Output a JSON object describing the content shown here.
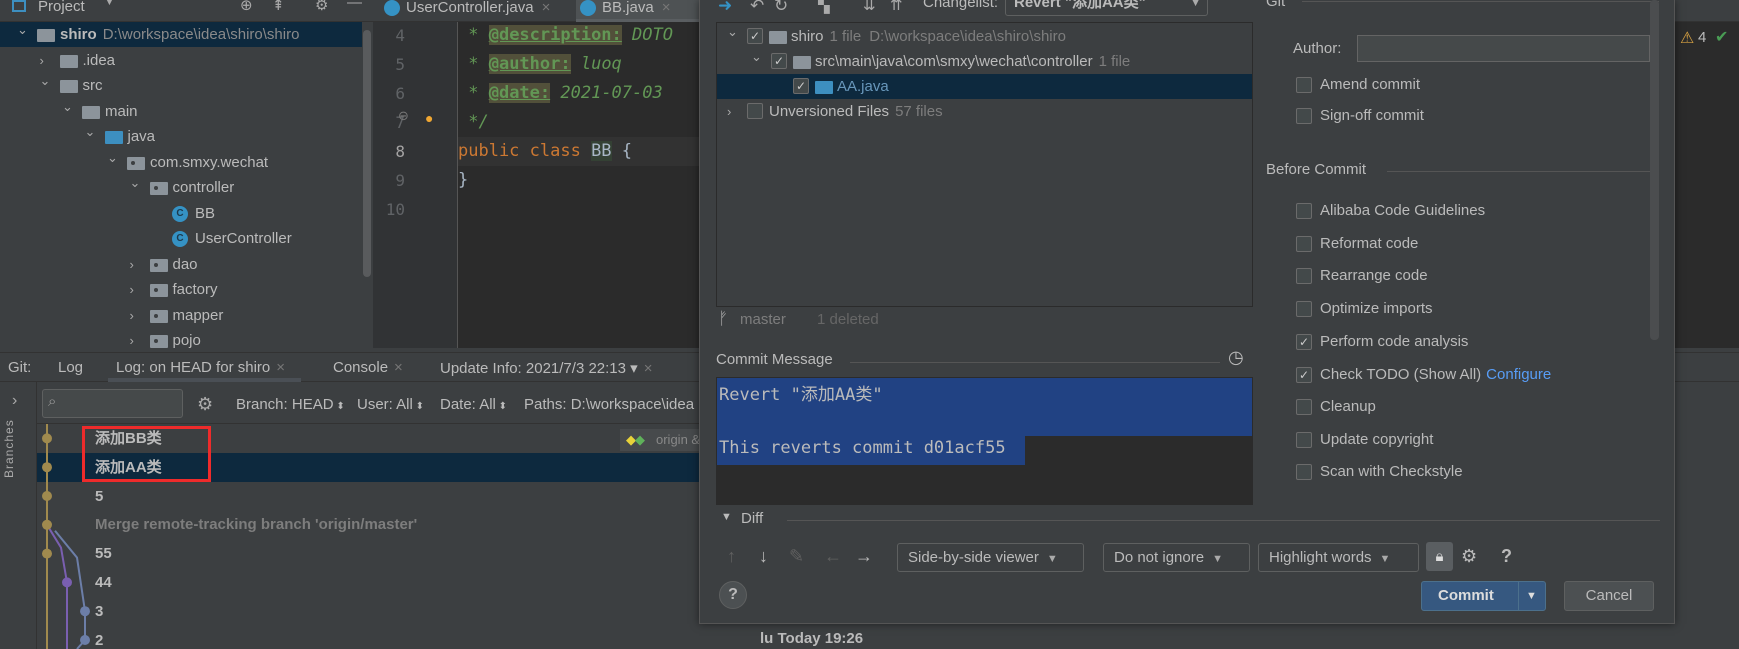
{
  "top_bar": {
    "project_label": "Project",
    "tabs": [
      {
        "label": "UserController.java",
        "active": false
      },
      {
        "label": "BB.java",
        "active": true
      }
    ]
  },
  "project_tree": {
    "items": [
      {
        "label": "shiro",
        "path": "D:\\workspace\\idea\\shiro\\shiro",
        "depth": 0,
        "chevron": "down",
        "icon": "module-folder",
        "selected": true
      },
      {
        "label": ".idea",
        "depth": 1,
        "chevron": "right",
        "icon": "folder"
      },
      {
        "label": "src",
        "depth": 1,
        "chevron": "down",
        "icon": "folder"
      },
      {
        "label": "main",
        "depth": 2,
        "chevron": "down",
        "icon": "folder"
      },
      {
        "label": "java",
        "depth": 3,
        "chevron": "down",
        "icon": "source-folder"
      },
      {
        "label": "com.smxy.wechat",
        "depth": 4,
        "chevron": "down",
        "icon": "package"
      },
      {
        "label": "controller",
        "depth": 5,
        "chevron": "down",
        "icon": "package"
      },
      {
        "label": "BB",
        "depth": 6,
        "chevron": "",
        "icon": "class"
      },
      {
        "label": "UserController",
        "depth": 6,
        "chevron": "",
        "icon": "class"
      },
      {
        "label": "dao",
        "depth": 5,
        "chevron": "right",
        "icon": "package"
      },
      {
        "label": "factory",
        "depth": 5,
        "chevron": "right",
        "icon": "package"
      },
      {
        "label": "mapper",
        "depth": 5,
        "chevron": "right",
        "icon": "package"
      },
      {
        "label": "pojo",
        "depth": 5,
        "chevron": "right",
        "icon": "package"
      }
    ]
  },
  "editor": {
    "lines": [
      {
        "num": "4",
        "parts": [
          {
            "t": " * ",
            "c": "doc"
          },
          {
            "t": "@description:",
            "c": "tag"
          },
          {
            "t": " DOTO",
            "c": "doc"
          }
        ]
      },
      {
        "num": "5",
        "parts": [
          {
            "t": " * ",
            "c": "doc"
          },
          {
            "t": "@author:",
            "c": "tag"
          },
          {
            "t": " luoq",
            "c": "doc"
          }
        ]
      },
      {
        "num": "6",
        "parts": [
          {
            "t": " * ",
            "c": "doc"
          },
          {
            "t": "@date:",
            "c": "tag"
          },
          {
            "t": " 2021-07-03",
            "c": "doc"
          }
        ]
      },
      {
        "num": "7",
        "parts": [
          {
            "t": " */",
            "c": "doc"
          }
        ]
      },
      {
        "num": "8",
        "current": true,
        "parts": [
          {
            "t": "public class ",
            "c": "kw"
          },
          {
            "t": "BB",
            "c": "cls"
          },
          {
            "t": " {",
            "c": "plain"
          }
        ]
      },
      {
        "num": "9",
        "parts": [
          {
            "t": "}",
            "c": "plain"
          }
        ]
      },
      {
        "num": "10",
        "parts": []
      }
    ],
    "warnings_count": "4"
  },
  "bottom_panel": {
    "tabs": [
      {
        "label": "Git:",
        "closable": false
      },
      {
        "label": "Log",
        "closable": false
      },
      {
        "label": "Log: on HEAD for shiro",
        "closable": true,
        "active": true
      },
      {
        "label": "Console",
        "closable": true
      },
      {
        "label": "Update Info: 2021/7/3 22:13",
        "closable": true,
        "dropdown": true
      }
    ],
    "branches_label": "Branches",
    "filters": [
      "Branch: HEAD",
      "User: All",
      "Date: All",
      "Paths: D:\\workspace\\idea"
    ],
    "commits": [
      {
        "message": "添加BB类"
      },
      {
        "message": "添加AA类",
        "selected": true
      },
      {
        "message": "5"
      },
      {
        "message": "Merge remote-tracking branch 'origin/master'",
        "merge": true
      },
      {
        "message": "55"
      },
      {
        "message": "44"
      },
      {
        "message": "3"
      },
      {
        "message": "2"
      }
    ],
    "origin_tag": "origin & master",
    "author_time": "lu Today 19:26",
    "colors": {
      "graph_main": "#a08a4e",
      "graph_branch": "#7a5fb0",
      "graph_blue": "#6c7ea8",
      "highlight_box": "#ee2b2b"
    }
  },
  "dialog": {
    "toolbar": {
      "changelist_label": "Changelist:",
      "changelist_value": "Revert \"添加AA类\""
    },
    "changes": [
      {
        "label": "shiro",
        "count": "1 file",
        "path": "D:\\workspace\\idea\\shiro\\shiro",
        "checked": true,
        "chevron": "down"
      },
      {
        "label": "src\\main\\java\\com\\smxy\\wechat\\controller",
        "count": "1 file",
        "checked": true,
        "chevron": "down"
      },
      {
        "label": "AA.java",
        "checked": true,
        "selected": true
      },
      {
        "label": "Unversioned Files",
        "count": "57 files",
        "checked": false,
        "chevron": "right"
      }
    ],
    "branch": "master",
    "status": "1 deleted",
    "commit_message_label": "Commit Message",
    "commit_message": [
      "Revert \"添加AA类\"",
      "",
      "This reverts commit d01acf55"
    ],
    "diff_label": "Diff",
    "diff_options": {
      "viewer": "Side-by-side viewer",
      "whitespace": "Do not ignore",
      "highlight": "Highlight words"
    },
    "commit_label": "Commit",
    "cancel_label": "Cancel",
    "git_section_label": "Git",
    "author_label": "Author:",
    "author_value": "",
    "git_options": [
      {
        "label": "Amend commit",
        "checked": false
      },
      {
        "label": "Sign-off commit",
        "checked": false
      }
    ],
    "before_commit_label": "Before Commit",
    "before_commit_options": [
      {
        "label": "Alibaba Code Guidelines",
        "checked": false
      },
      {
        "label": "Reformat code",
        "checked": false
      },
      {
        "label": "Rearrange code",
        "checked": false
      },
      {
        "label": "Optimize imports",
        "checked": false
      },
      {
        "label": "Perform code analysis",
        "checked": true
      },
      {
        "label": "Check TODO (Show All)",
        "checked": true,
        "link": "Configure"
      },
      {
        "label": "Cleanup",
        "checked": false
      },
      {
        "label": "Update copyright",
        "checked": false
      },
      {
        "label": "Scan with Checkstyle",
        "checked": false
      }
    ],
    "colors": {
      "primary_button": "#365880",
      "selection": "#214283",
      "link": "#589df6"
    }
  }
}
